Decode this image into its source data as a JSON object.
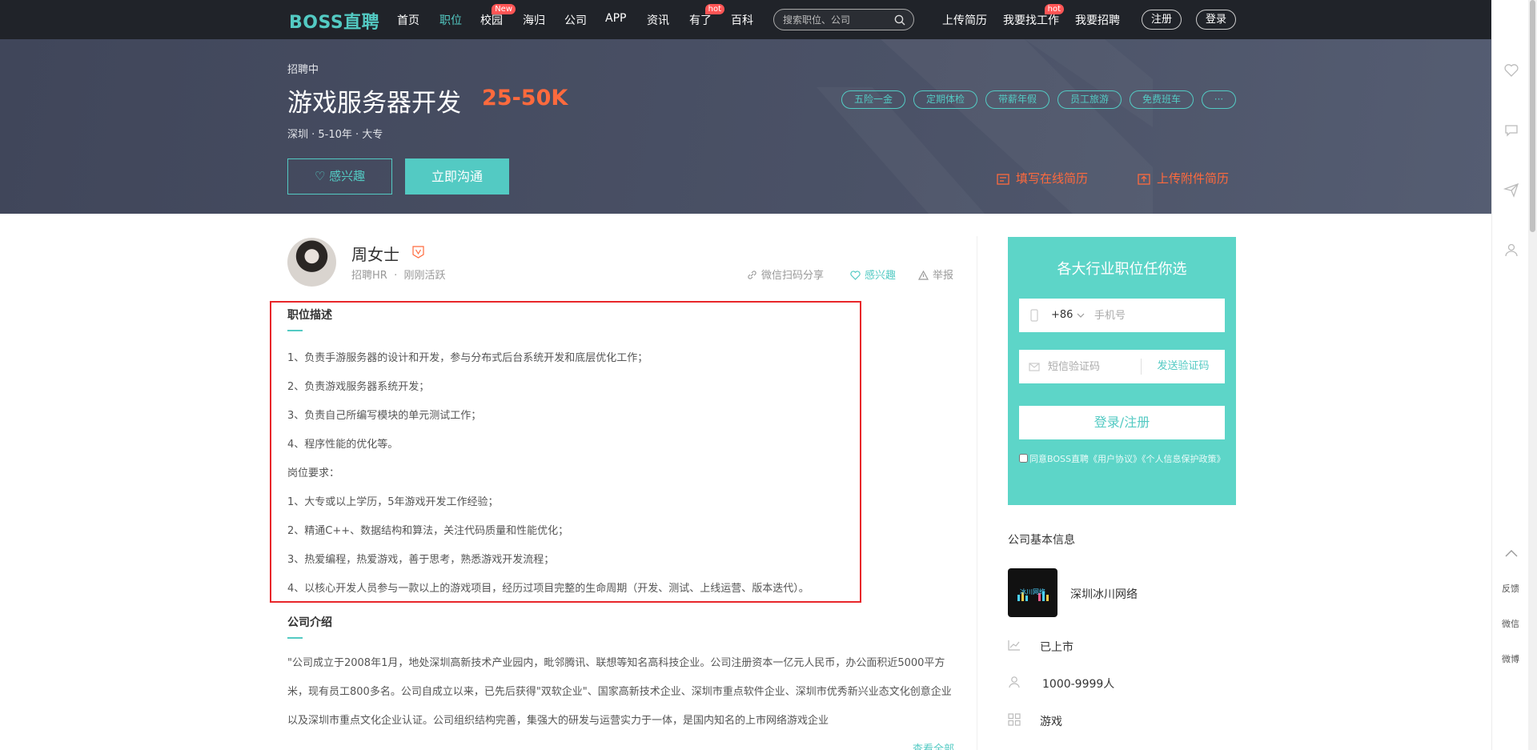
{
  "nav": {
    "logo": "BOSS直聘",
    "items": [
      {
        "label": "首页",
        "badge": ""
      },
      {
        "label": "职位",
        "badge": ""
      },
      {
        "label": "校园",
        "badge": "New"
      },
      {
        "label": "海归",
        "badge": ""
      },
      {
        "label": "公司",
        "badge": ""
      },
      {
        "label": "APP",
        "badge": ""
      },
      {
        "label": "资讯",
        "badge": ""
      },
      {
        "label": "有了",
        "badge": "hot"
      },
      {
        "label": "百科",
        "badge": ""
      }
    ],
    "search_placeholder": "搜索职位、公司",
    "right_items": [
      {
        "label": "上传简历",
        "badge": ""
      },
      {
        "label": "我要找工作",
        "badge": "hot"
      },
      {
        "label": "我要招聘",
        "badge": ""
      }
    ],
    "register": "注册",
    "login": "登录"
  },
  "job": {
    "status": "招聘中",
    "title": "游戏服务器开发",
    "salary": "25-50K",
    "meta": "深圳 · 5-10年 · 大专",
    "tags": [
      "五险一金",
      "定期体检",
      "带薪年假",
      "员工旅游",
      "免费班车",
      "···"
    ],
    "interest_button": "♡ 感兴趣",
    "chat_button": "立即沟通",
    "online_resume": "填写在线简历",
    "upload_resume": "上传附件简历"
  },
  "hr": {
    "name": "周女士",
    "role": "招聘HR",
    "separator": "·",
    "active": "刚刚活跃",
    "actions": {
      "share": "微信扫码分享",
      "interest": "感兴趣",
      "report": "举报"
    }
  },
  "description": {
    "title": "职位描述",
    "lines": [
      "1、负责手游服务器的设计和开发，参与分布式后台系统开发和底层优化工作；",
      "2、负责游戏服务器系统开发；",
      "3、负责自己所编写模块的单元测试工作；",
      "4、程序性能的优化等。",
      "岗位要求：",
      "1、大专或以上学历，5年游戏开发工作经验；",
      "2、精通C++、数据结构和算法，关注代码质量和性能优化；",
      "3、热爱编程，热爱游戏，善于思考，熟悉游戏开发流程；",
      "4、以核心开发人员参与一款以上的游戏项目，经历过项目完整的生命周期（开发、测试、上线运营、版本迭代）。"
    ]
  },
  "company_intro": {
    "title": "公司介绍",
    "text": "\"公司成立于2008年1月，地处深圳高新技术产业园内，毗邻腾讯、联想等知名高科技企业。公司注册资本一亿元人民币，办公面积近5000平方米，现有员工800多名。公司自成立以来，已先后获得\"双软企业\"、国家高新技术企业、深圳市重点软件企业、深圳市优秀新兴业态文化创意企业以及深圳市重点文化企业认证。公司组织结构完善，集强大的研发与运营实力于一体，是国内知名的上市网络游戏企业",
    "see_more": "查看全部"
  },
  "login_panel": {
    "title": "各大行业职位任你选",
    "country_code": "+86",
    "phone_placeholder": "手机号",
    "code_placeholder": "短信验证码",
    "send_code": "发送验证码",
    "login_button": "登录/注册",
    "agree_text": "同意BOSS直聘《用户协议》《个人信息保护政策》"
  },
  "company": {
    "section_title": "公司基本信息",
    "logo_text": "冰川网络",
    "name": "深圳冰川网络",
    "stage": "已上市",
    "size": "1000-9999人",
    "industry": "游戏"
  },
  "right_sidebar": {
    "feedback": "反馈",
    "wechat": "微信",
    "weibo": "微博"
  },
  "colors": {
    "accent": "#53cac3",
    "salary": "#ff6a3d",
    "highlight": "#e8262a",
    "nav_bg": "#202329"
  }
}
